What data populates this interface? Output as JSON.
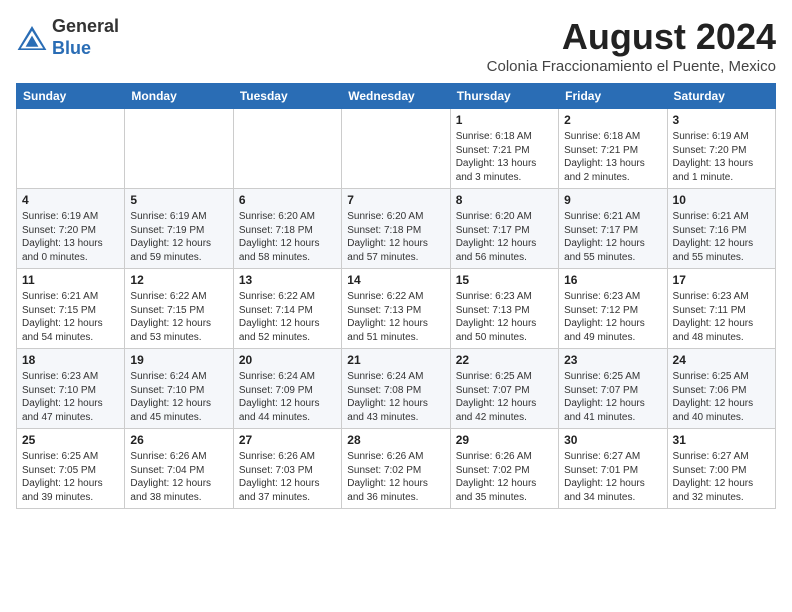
{
  "logo": {
    "general": "General",
    "blue": "Blue"
  },
  "title": "August 2024",
  "subtitle": "Colonia Fraccionamiento el Puente, Mexico",
  "days_of_week": [
    "Sunday",
    "Monday",
    "Tuesday",
    "Wednesday",
    "Thursday",
    "Friday",
    "Saturday"
  ],
  "weeks": [
    [
      {
        "day": null,
        "info": null
      },
      {
        "day": null,
        "info": null
      },
      {
        "day": null,
        "info": null
      },
      {
        "day": null,
        "info": null
      },
      {
        "day": "1",
        "sunrise": "6:18 AM",
        "sunset": "7:21 PM",
        "daylight": "13 hours and 3 minutes."
      },
      {
        "day": "2",
        "sunrise": "6:18 AM",
        "sunset": "7:21 PM",
        "daylight": "13 hours and 2 minutes."
      },
      {
        "day": "3",
        "sunrise": "6:19 AM",
        "sunset": "7:20 PM",
        "daylight": "13 hours and 1 minute."
      }
    ],
    [
      {
        "day": "4",
        "sunrise": "6:19 AM",
        "sunset": "7:20 PM",
        "daylight": "13 hours and 0 minutes."
      },
      {
        "day": "5",
        "sunrise": "6:19 AM",
        "sunset": "7:19 PM",
        "daylight": "12 hours and 59 minutes."
      },
      {
        "day": "6",
        "sunrise": "6:20 AM",
        "sunset": "7:18 PM",
        "daylight": "12 hours and 58 minutes."
      },
      {
        "day": "7",
        "sunrise": "6:20 AM",
        "sunset": "7:18 PM",
        "daylight": "12 hours and 57 minutes."
      },
      {
        "day": "8",
        "sunrise": "6:20 AM",
        "sunset": "7:17 PM",
        "daylight": "12 hours and 56 minutes."
      },
      {
        "day": "9",
        "sunrise": "6:21 AM",
        "sunset": "7:17 PM",
        "daylight": "12 hours and 55 minutes."
      },
      {
        "day": "10",
        "sunrise": "6:21 AM",
        "sunset": "7:16 PM",
        "daylight": "12 hours and 55 minutes."
      }
    ],
    [
      {
        "day": "11",
        "sunrise": "6:21 AM",
        "sunset": "7:15 PM",
        "daylight": "12 hours and 54 minutes."
      },
      {
        "day": "12",
        "sunrise": "6:22 AM",
        "sunset": "7:15 PM",
        "daylight": "12 hours and 53 minutes."
      },
      {
        "day": "13",
        "sunrise": "6:22 AM",
        "sunset": "7:14 PM",
        "daylight": "12 hours and 52 minutes."
      },
      {
        "day": "14",
        "sunrise": "6:22 AM",
        "sunset": "7:13 PM",
        "daylight": "12 hours and 51 minutes."
      },
      {
        "day": "15",
        "sunrise": "6:23 AM",
        "sunset": "7:13 PM",
        "daylight": "12 hours and 50 minutes."
      },
      {
        "day": "16",
        "sunrise": "6:23 AM",
        "sunset": "7:12 PM",
        "daylight": "12 hours and 49 minutes."
      },
      {
        "day": "17",
        "sunrise": "6:23 AM",
        "sunset": "7:11 PM",
        "daylight": "12 hours and 48 minutes."
      }
    ],
    [
      {
        "day": "18",
        "sunrise": "6:23 AM",
        "sunset": "7:10 PM",
        "daylight": "12 hours and 47 minutes."
      },
      {
        "day": "19",
        "sunrise": "6:24 AM",
        "sunset": "7:10 PM",
        "daylight": "12 hours and 45 minutes."
      },
      {
        "day": "20",
        "sunrise": "6:24 AM",
        "sunset": "7:09 PM",
        "daylight": "12 hours and 44 minutes."
      },
      {
        "day": "21",
        "sunrise": "6:24 AM",
        "sunset": "7:08 PM",
        "daylight": "12 hours and 43 minutes."
      },
      {
        "day": "22",
        "sunrise": "6:25 AM",
        "sunset": "7:07 PM",
        "daylight": "12 hours and 42 minutes."
      },
      {
        "day": "23",
        "sunrise": "6:25 AM",
        "sunset": "7:07 PM",
        "daylight": "12 hours and 41 minutes."
      },
      {
        "day": "24",
        "sunrise": "6:25 AM",
        "sunset": "7:06 PM",
        "daylight": "12 hours and 40 minutes."
      }
    ],
    [
      {
        "day": "25",
        "sunrise": "6:25 AM",
        "sunset": "7:05 PM",
        "daylight": "12 hours and 39 minutes."
      },
      {
        "day": "26",
        "sunrise": "6:26 AM",
        "sunset": "7:04 PM",
        "daylight": "12 hours and 38 minutes."
      },
      {
        "day": "27",
        "sunrise": "6:26 AM",
        "sunset": "7:03 PM",
        "daylight": "12 hours and 37 minutes."
      },
      {
        "day": "28",
        "sunrise": "6:26 AM",
        "sunset": "7:02 PM",
        "daylight": "12 hours and 36 minutes."
      },
      {
        "day": "29",
        "sunrise": "6:26 AM",
        "sunset": "7:02 PM",
        "daylight": "12 hours and 35 minutes."
      },
      {
        "day": "30",
        "sunrise": "6:27 AM",
        "sunset": "7:01 PM",
        "daylight": "12 hours and 34 minutes."
      },
      {
        "day": "31",
        "sunrise": "6:27 AM",
        "sunset": "7:00 PM",
        "daylight": "12 hours and 32 minutes."
      }
    ]
  ]
}
